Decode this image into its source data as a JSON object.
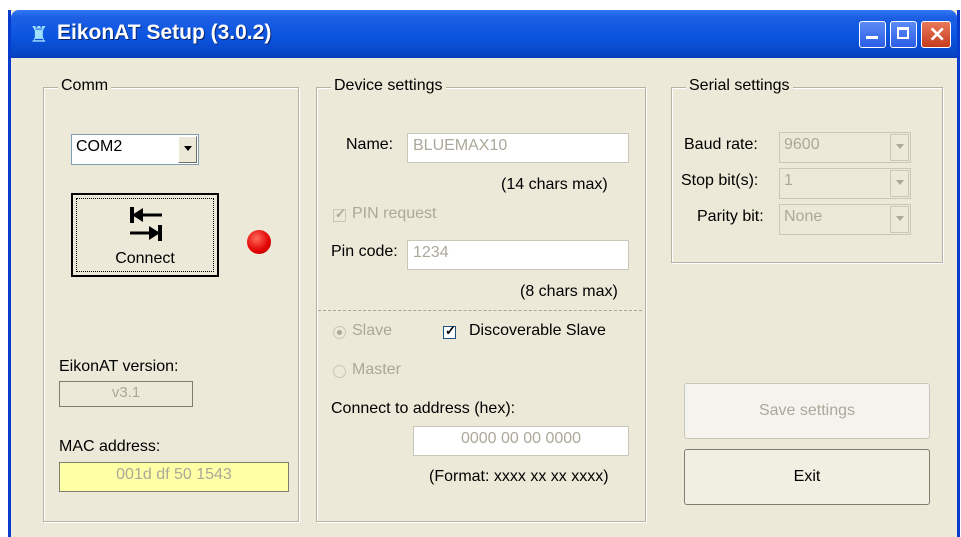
{
  "window": {
    "title": "EikonAT Setup (3.0.2)",
    "controls": {
      "minimize": "minimize-icon",
      "maximize": "maximize-icon",
      "close": "close-icon"
    }
  },
  "comm": {
    "group_label": "Comm",
    "port": "COM2",
    "connect_label": "Connect",
    "status_color": "#e10000",
    "version_label": "EikonAT version:",
    "version_value": "v3.1",
    "mac_label": "MAC address:",
    "mac_value": "001d df 50 1543"
  },
  "device": {
    "group_label": "Device settings",
    "name_label": "Name:",
    "name_value": "BLUEMAX10",
    "name_hint": "(14 chars max)",
    "pin_request_label": "PIN request",
    "pin_request_checked": true,
    "pin_code_label": "Pin code:",
    "pin_code_value": "1234",
    "pin_hint": "(8 chars max)",
    "slave_label": "Slave",
    "master_label": "Master",
    "discoverable_label": "Discoverable Slave",
    "discoverable_checked": true,
    "address_label": "Connect to address (hex):",
    "address_value": "0000 00 00 0000",
    "address_hint": "(Format: xxxx xx xx xxxx)"
  },
  "serial": {
    "group_label": "Serial settings",
    "baud_label": "Baud rate:",
    "baud_value": "9600",
    "stop_label": "Stop bit(s):",
    "stop_value": "1",
    "parity_label": "Parity bit:",
    "parity_value": "None"
  },
  "actions": {
    "save_label": "Save settings",
    "exit_label": "Exit"
  }
}
